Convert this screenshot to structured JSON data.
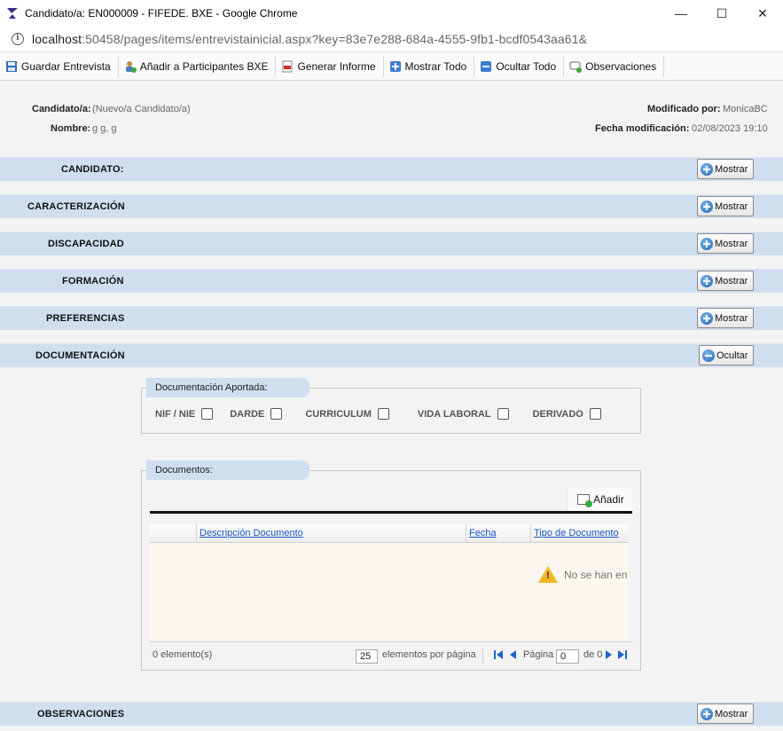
{
  "window": {
    "title": "Candidato/a: EN000009 - FIFEDE. BXE - Google Chrome",
    "minimize": "—",
    "maximize": "☐",
    "close": "✕"
  },
  "urlbar": {
    "host": "localhost",
    "path": ":50458/pages/items/entrevistainicial.aspx?key=83e7e288-684a-4555-9fb1-bcdf0543aa61&"
  },
  "toolbar": {
    "save": "Guardar Entrevista",
    "add_participants": "Añadir a Participantes BXE",
    "report": "Generar Informe",
    "show_all": "Mostrar Todo",
    "hide_all": "Ocultar Todo",
    "observations": "Observaciones"
  },
  "header": {
    "candidate_label": "Candidato/a:",
    "candidate_value": "(Nuevo/a Candidato/a)",
    "name_label": "Nombre:",
    "name_value": "g g, g",
    "modified_by_label": "Modificado por:",
    "modified_by_value": "MonicaBC",
    "modified_date_label": "Fecha modificación:",
    "modified_date_value": "02/08/2023 19:10"
  },
  "sections": [
    {
      "title": "CANDIDATO:",
      "button": "Mostrar"
    },
    {
      "title": "CARACTERIZACIÓN",
      "button": "Mostrar"
    },
    {
      "title": "DISCAPACIDAD",
      "button": "Mostrar"
    },
    {
      "title": "FORMACIÓN",
      "button": "Mostrar"
    },
    {
      "title": "PREFERENCIAS",
      "button": "Mostrar"
    },
    {
      "title": "DOCUMENTACIÓN",
      "button": "Ocultar"
    },
    {
      "title": "OBSERVACIONES",
      "button": "Mostrar"
    }
  ],
  "documentacion": {
    "legend": "Documentación Aportada:",
    "checks": [
      "NIF / NIE",
      "DARDE",
      "CURRICULUM",
      "VIDA LABORAL",
      "DERIVADO"
    ]
  },
  "documentos": {
    "legend": "Documentos:",
    "add": "Añadir",
    "columns": [
      "Descripción Documento",
      "Fecha",
      "Tipo de Documento"
    ],
    "empty": "No se han en",
    "count": "0 elemento(s)",
    "page_size": "25",
    "page_size_label": "elementos por página",
    "page_label": "Página",
    "page": "0",
    "of": "de 0"
  }
}
